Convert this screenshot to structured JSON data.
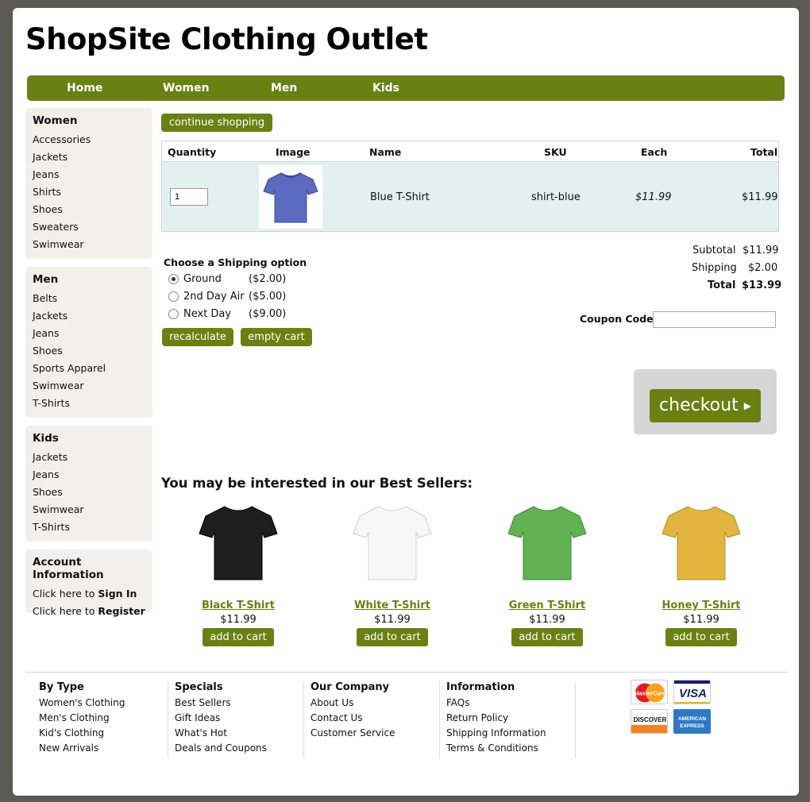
{
  "site": {
    "title": "ShopSite Clothing Outlet"
  },
  "nav": [
    "Home",
    "Women",
    "Men",
    "Kids"
  ],
  "sidebar": {
    "women": {
      "title": "Women",
      "items": [
        "Accessories",
        "Jackets",
        "Jeans",
        "Shirts",
        "Shoes",
        "Sweaters",
        "Swimwear"
      ]
    },
    "men": {
      "title": "Men",
      "items": [
        "Belts",
        "Jackets",
        "Jeans",
        "Shoes",
        "Sports Apparel",
        "Swimwear",
        "T-Shirts"
      ]
    },
    "kids": {
      "title": "Kids",
      "items": [
        "Jackets",
        "Jeans",
        "Shoes",
        "Swimwear",
        "T-Shirts"
      ]
    },
    "account": {
      "title": "Account Information",
      "signin_prefix": "Click here to ",
      "signin": "Sign In",
      "register_prefix": "Click here to ",
      "register": "Register"
    }
  },
  "buttons": {
    "continue": "continue shopping",
    "recalculate": "recalculate",
    "empty": "empty cart",
    "checkout": "checkout"
  },
  "cart": {
    "headers": [
      "Quantity",
      "Image",
      "Name",
      "SKU",
      "Each",
      "Total"
    ],
    "item": {
      "quantity": "1",
      "name": "Blue T-Shirt",
      "sku": "shirt-blue",
      "each": "$11.99",
      "total": "$11.99",
      "color": "#5b69c0"
    }
  },
  "summary": {
    "subtotal_label": "Subtotal",
    "subtotal": "$11.99",
    "shipping_label": "Shipping",
    "shipping": "$2.00",
    "total_label": "Total",
    "total": "$13.99",
    "coupon_label": "Coupon Code:"
  },
  "shipping": {
    "title": "Choose a Shipping option",
    "options": [
      {
        "label": "Ground",
        "price": "($2.00)",
        "selected": true
      },
      {
        "label": "2nd Day Air",
        "price": "($5.00)",
        "selected": false
      },
      {
        "label": "Next Day",
        "price": "($9.00)",
        "selected": false
      }
    ]
  },
  "best_sellers": {
    "title": "You may be interested in our Best Sellers:",
    "add_label": "add to cart",
    "items": [
      {
        "name": "Black T-Shirt",
        "price": "$11.99",
        "color": "#1e1e1e"
      },
      {
        "name": "White T-Shirt",
        "price": "$11.99",
        "color": "#f7f7f7"
      },
      {
        "name": "Green T-Shirt",
        "price": "$11.99",
        "color": "#62b253"
      },
      {
        "name": "Honey T-Shirt",
        "price": "$11.99",
        "color": "#e2b440"
      }
    ]
  },
  "footer": {
    "columns": [
      {
        "title": "By Type",
        "links": [
          "Women's Clothing",
          "Men's Clothing",
          "Kid's Clothing",
          "New Arrivals"
        ]
      },
      {
        "title": "Specials",
        "links": [
          "Best Sellers",
          "Gift Ideas",
          "What's Hot",
          "Deals and Coupons"
        ]
      },
      {
        "title": "Our Company",
        "links": [
          "About Us",
          "Contact Us",
          "Customer Service"
        ]
      },
      {
        "title": "Information",
        "links": [
          "FAQs",
          "Return Policy",
          "Shipping Information",
          "Terms & Conditions"
        ]
      }
    ],
    "cards": {
      "mastercard": "MasterCard",
      "visa": "VISA",
      "discover": "DISCOVER",
      "amex_line1": "AMERICAN",
      "amex_line2": "EXPRESS"
    }
  },
  "colors": {
    "accent": "#6b8013",
    "cart_row": "#e2f0f0",
    "sidebar": "#f1f0ed",
    "background": "#5c5a55"
  }
}
